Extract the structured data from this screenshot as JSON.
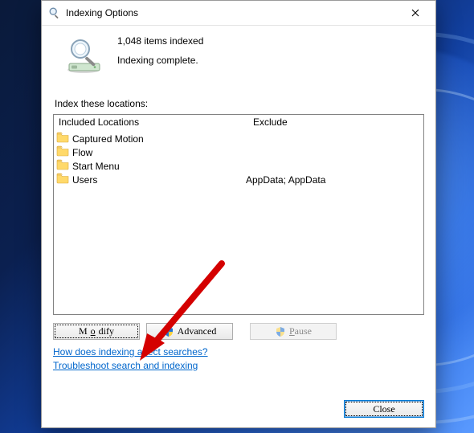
{
  "title": "Indexing Options",
  "items_indexed": "1,048 items indexed",
  "status": "Indexing complete.",
  "section_label": "Index these locations:",
  "headers": {
    "included": "Included Locations",
    "exclude": "Exclude"
  },
  "locations": [
    {
      "name": "Captured Motion",
      "exclude": ""
    },
    {
      "name": "Flow",
      "exclude": ""
    },
    {
      "name": "Start Menu",
      "exclude": ""
    },
    {
      "name": "Users",
      "exclude": "AppData; AppData"
    }
  ],
  "buttons": {
    "modify_pre": "M",
    "modify_u": "o",
    "modify_post": "dify",
    "advanced": "Advanced",
    "pause_u": "P",
    "pause_post": "ause",
    "close": "Close"
  },
  "links": {
    "how": "How does indexing affect searches?",
    "troubleshoot": "Troubleshoot search and indexing"
  }
}
